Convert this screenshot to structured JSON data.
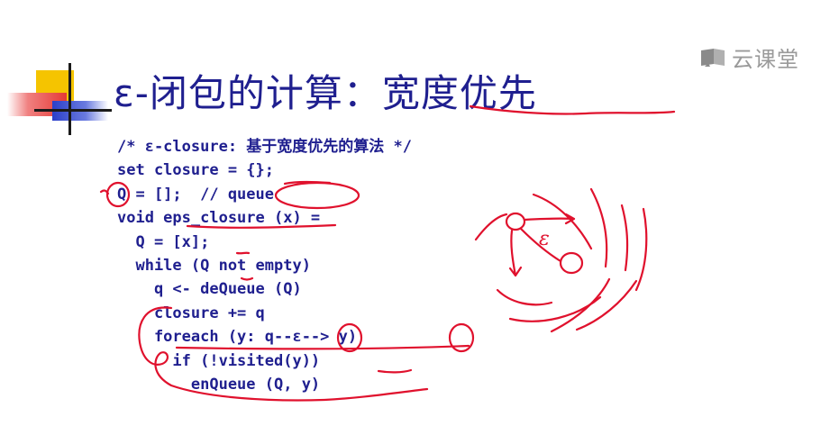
{
  "slide": {
    "title": "ε-闭包的计算：宽度优先",
    "watermark": "云课堂",
    "code_lines": [
      "/* ε-closure: 基于宽度优先的算法 */",
      "set closure = {};",
      "Q = [];  // queue",
      "void eps_closure (x) =",
      "  Q = [x];",
      "  while (Q not empty)",
      "    q <- deQueue (Q)",
      "    closure += q",
      "    foreach (y: q--ε--> y)",
      "      if (!visited(y))",
      "        enQueue (Q, y)"
    ],
    "annotation": {
      "epsilon_label": "ε"
    }
  },
  "colors": {
    "text": "#1f1f8f",
    "annotation": "#e0112d",
    "watermark": "#9a9a9a"
  }
}
